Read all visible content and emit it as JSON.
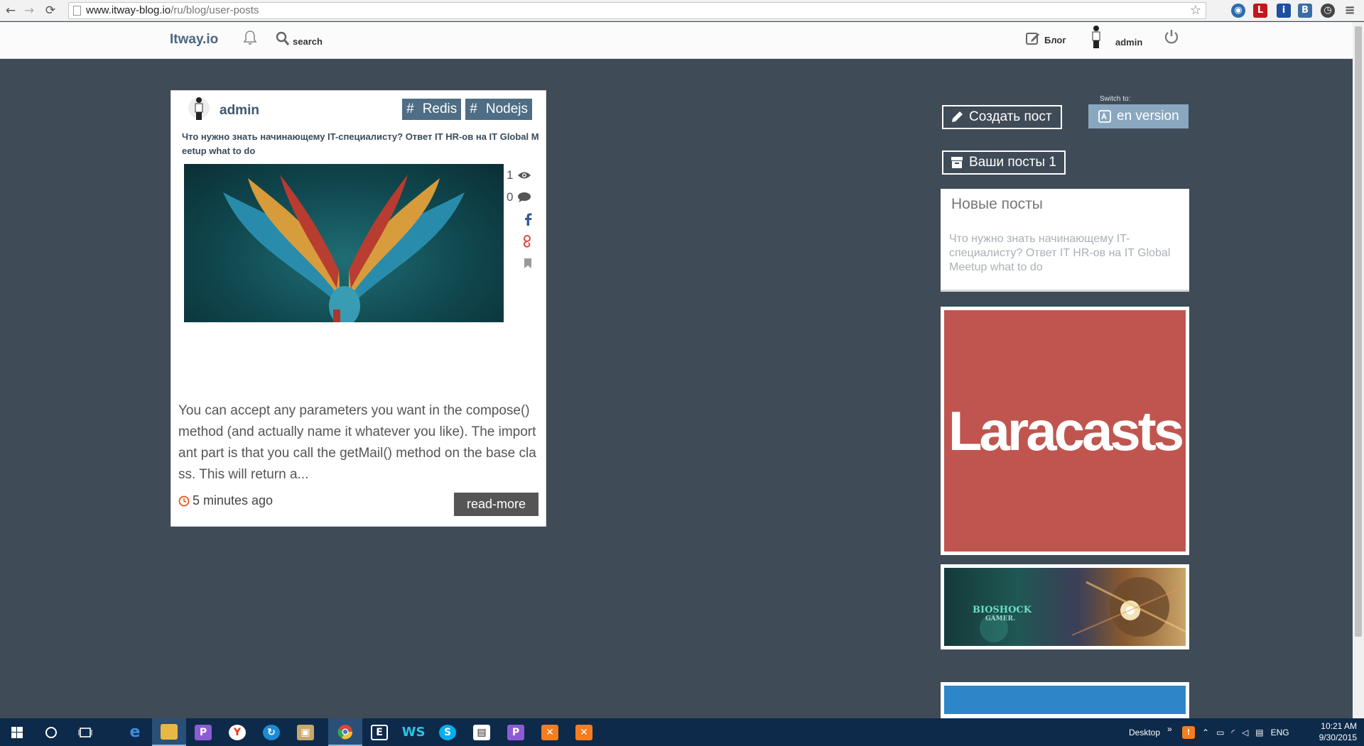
{
  "browser": {
    "url_host": "www.itway-blog.io",
    "url_path": "/ru/blog/user-posts",
    "back_glyph": "←",
    "forward_glyph": "→",
    "reload_glyph": "⟳",
    "star_glyph": "☆",
    "menu_glyph": "≡"
  },
  "header": {
    "logo": "Itway.io",
    "search_label": "search",
    "blog_label": "Блог",
    "user_label": "admin"
  },
  "post": {
    "author": "admin",
    "tags": [
      {
        "hash": "#",
        "label": "Redis"
      },
      {
        "hash": "#",
        "label": "Nodejs"
      }
    ],
    "title": "Что нужно знать начинающему IT-специалисту? Ответ IT HR-ов на IT Global Meetup what to do",
    "views": "1",
    "comments": "0",
    "excerpt": "You can accept any parameters you want in the compose() method (and actually name it whatever you like). The important part is that you call the getMail() method on the base class. This will return a...",
    "time": "5 minutes ago",
    "read_more": "read-more"
  },
  "sidebar": {
    "create_post": "Создать пост",
    "switch_to": "Switch to:",
    "en_version": "en version",
    "your_posts": "Ваши посты 1",
    "new_posts_title": "Новые посты",
    "new_post_link": "Что нужно знать начинающему IT-специалисту? Ответ IT HR-ов на IT Global Meetup what to do",
    "ad1_text": "Laracasts",
    "ad2_title": "BIOSHOCK",
    "ad2_subtitle": "GAMER."
  },
  "taskbar": {
    "desktop_label": "Desktop",
    "chevron": "»",
    "lang": "ENG",
    "time": "10:21 AM",
    "date": "9/30/2015"
  },
  "colors": {
    "page_bg": "#3f4b57",
    "tag_bg": "#4f6d84",
    "en_button_bg": "#8aa7c0",
    "laracasts_red": "#c0554f",
    "taskbar_bg": "#0d2a4a"
  }
}
